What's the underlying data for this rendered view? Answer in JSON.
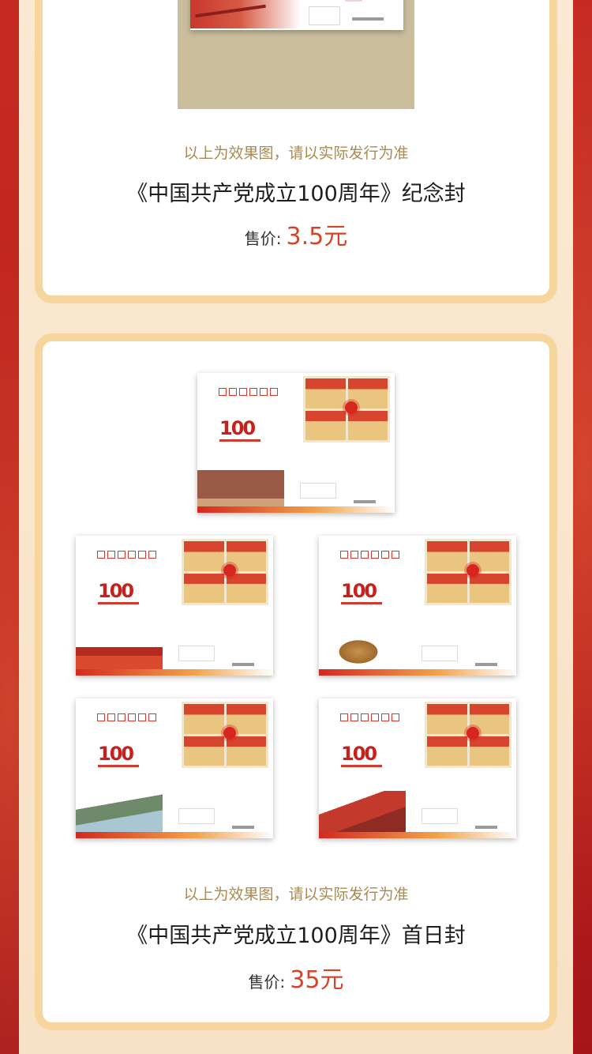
{
  "sections": [
    {
      "note": "以上为效果图，请以实际发行为准",
      "title": "《中国共产党成立100周年》纪念封",
      "price_label": "售价:",
      "price_value": "3.5元"
    },
    {
      "note": "以上为效果图，请以实际发行为准",
      "title": "《中国共产党成立100周年》首日封",
      "price_label": "售价:",
      "price_value": "35元",
      "covers": [
        {
          "logo": "100",
          "scene": "former-site"
        },
        {
          "logo": "100",
          "scene": "tiananmen-gate"
        },
        {
          "logo": "100",
          "scene": "bull-statue"
        },
        {
          "logo": "100",
          "scene": "mountains"
        },
        {
          "logo": "100",
          "scene": "great-wall"
        }
      ]
    }
  ],
  "colors": {
    "background_red": "#b9201c",
    "panel_cream": "#fbe9d3",
    "card_border": "#f7d69d",
    "note_text": "#a98a53",
    "price_accent": "#d3452a"
  }
}
